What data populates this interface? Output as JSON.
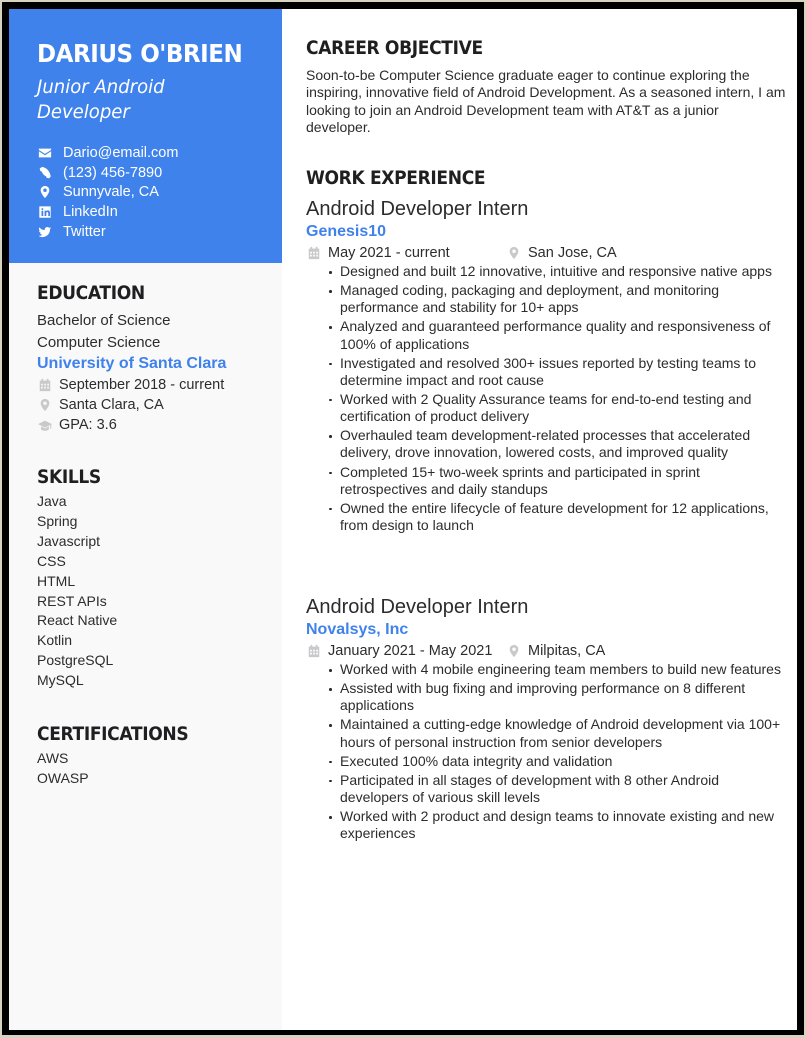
{
  "header": {
    "name": "DARIUS O'BRIEN",
    "role": "Junior Android Developer",
    "accent_color": "#3f82ec",
    "contacts": [
      {
        "icon": "envelope-icon",
        "text": "Dario@email.com"
      },
      {
        "icon": "phone-icon",
        "text": "(123) 456-7890"
      },
      {
        "icon": "map-pin-icon",
        "text": "Sunnyvale, CA"
      },
      {
        "icon": "linkedin-icon",
        "text": "LinkedIn"
      },
      {
        "icon": "twitter-icon",
        "text": "Twitter"
      }
    ]
  },
  "education": {
    "heading": "EDUCATION",
    "degree": "Bachelor of Science",
    "field": "Computer Science",
    "school": "University of Santa Clara",
    "dates": "September 2018 - current",
    "location": "Santa Clara, CA",
    "gpa": "GPA: 3.6"
  },
  "skills": {
    "heading": "SKILLS",
    "items": [
      "Java",
      "Spring",
      "Javascript",
      "CSS",
      "HTML",
      "REST APIs",
      "React Native",
      "Kotlin",
      "PostgreSQL",
      "MySQL"
    ]
  },
  "certifications": {
    "heading": "CERTIFICATIONS",
    "items": [
      "AWS",
      "OWASP"
    ]
  },
  "objective": {
    "heading": "CAREER OBJECTIVE",
    "text": "Soon-to-be Computer Science graduate eager to continue exploring the inspiring, innovative field of Android Development. As a seasoned intern, I am looking to join an Android Development team with AT&T as a junior developer."
  },
  "experience": {
    "heading": "WORK EXPERIENCE",
    "jobs": [
      {
        "title": "Android Developer Intern",
        "company": "Genesis10",
        "dates": "May 2021 - current",
        "location": "San Jose, CA",
        "bullets": [
          "Designed and built 12 innovative, intuitive and responsive native apps",
          "Managed coding, packaging and deployment, and monitoring performance and stability for 10+ apps",
          "Analyzed and guaranteed performance quality and responsiveness of 100% of applications",
          "Investigated and resolved 300+ issues reported by testing teams to determine impact and root cause",
          "Worked with 2 Quality Assurance teams for end-to-end testing and certification of product delivery",
          "Overhauled team development-related processes that accelerated delivery, drove innovation, lowered costs, and improved quality",
          "Completed 15+ two-week sprints and participated in sprint retrospectives and daily standups",
          "Owned the entire lifecycle of feature development for 12 applications, from design to launch"
        ]
      },
      {
        "title": "Android Developer Intern",
        "company": "Novalsys, Inc",
        "dates": "January 2021 - May 2021",
        "location": "Milpitas, CA",
        "bullets": [
          "Worked with 4 mobile engineering team members to build new features",
          "Assisted with bug fixing and improving performance on 8 different applications",
          "Maintained a cutting-edge knowledge of Android development via 100+ hours of personal instruction from senior developers",
          "Executed 100% data integrity and validation",
          "Participated in all stages of development with 8 other Android developers of various skill levels",
          "Worked with 2 product and design teams to innovate existing and new experiences"
        ]
      }
    ]
  }
}
